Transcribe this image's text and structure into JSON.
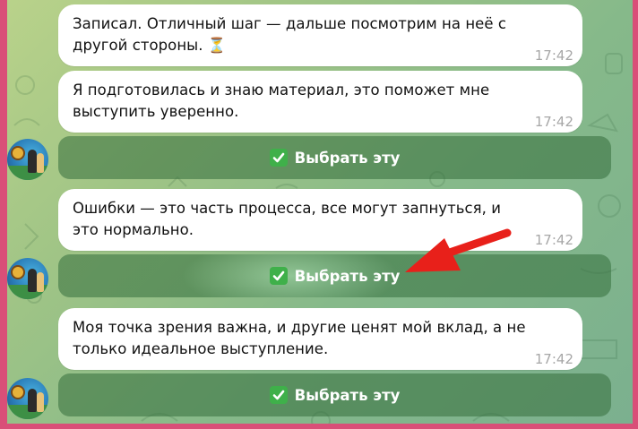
{
  "colors": {
    "frame": "#d94f78",
    "bubble": "#ffffff",
    "time": "#a7a7a7",
    "button_bg": "#346e3c",
    "check": "#3fb04a",
    "arrow": "#e8201a"
  },
  "messages": [
    {
      "text": "Записал. Отличный шаг — дальше посмотрим на неё с другой стороны. ⏳",
      "time": "17:42"
    },
    {
      "text": "Я подготовилась и знаю материал, это поможет мне выступить уверенно.",
      "time": "17:42"
    },
    {
      "text": "Ошибки — это часть процесса, все могут запнуться, и это нормально.",
      "time": "17:42"
    },
    {
      "text": "Моя точка зрения важна, и другие ценят мой вклад, а не только идеальное выступление.",
      "time": "17:42"
    }
  ],
  "buttons": [
    {
      "label": "Выбрать эту"
    },
    {
      "label": "Выбрать эту"
    },
    {
      "label": "Выбрать эту"
    }
  ],
  "icons": {
    "check": "white-heavy-check-mark-icon",
    "arrow": "red-arrow-pointer-icon",
    "avatar": "bot-avatar"
  }
}
